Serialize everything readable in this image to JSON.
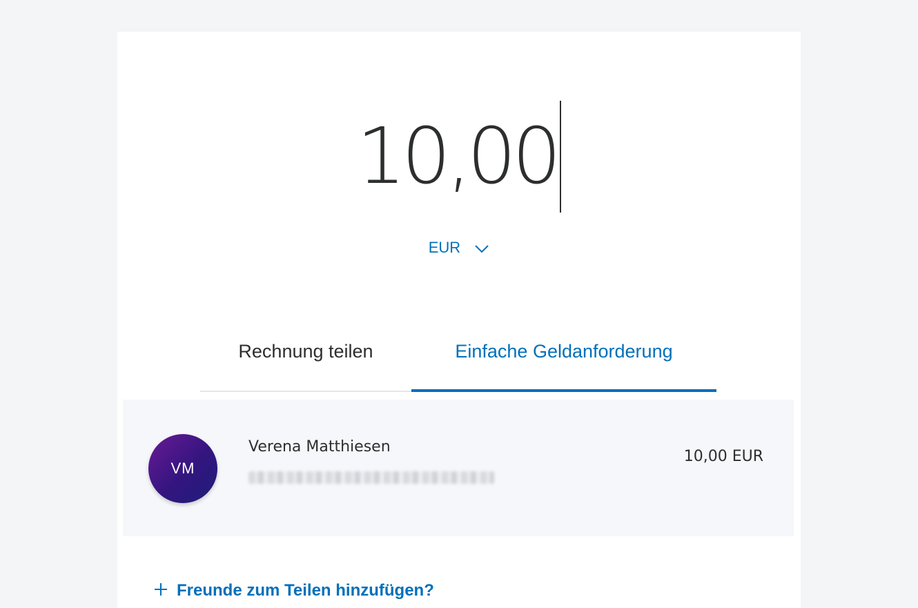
{
  "amount": {
    "value": "10,00"
  },
  "currency": {
    "code": "EUR",
    "icon": "chevron-down-icon"
  },
  "tabs": [
    {
      "label": "Rechnung teilen",
      "active": false
    },
    {
      "label": "Einfache Geldanforderung",
      "active": true
    }
  ],
  "recipient": {
    "initials": "VM",
    "name": "Verena Matthiesen",
    "amount": "10,00 EUR"
  },
  "add_friends": {
    "label": "Freunde zum Teilen hinzufügen?",
    "icon": "plus-icon"
  },
  "colors": {
    "accent": "#0070ba",
    "text": "#2c2e2f",
    "background": "#f4f5f7",
    "recipient_background": "#f5f7fa"
  }
}
